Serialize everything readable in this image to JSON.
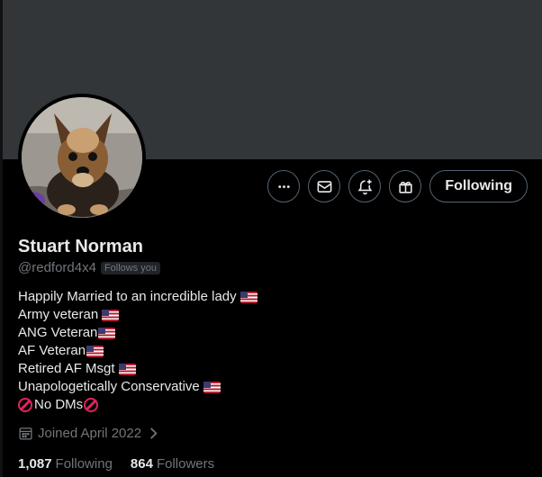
{
  "profile": {
    "display_name": "Stuart Norman",
    "handle": "@redford4x4",
    "follows_you_badge": "Follows you",
    "bio": [
      {
        "text": "Happily Married to an incredible lady",
        "suffix": "flag"
      },
      {
        "text": "Army veteran",
        "suffix": "flag"
      },
      {
        "text": "ANG Veteran",
        "suffix": "flag-tight"
      },
      {
        "text": "AF Veteran",
        "suffix": "flag-tight"
      },
      {
        "text": "Retired AF Msgt",
        "suffix": "flag"
      },
      {
        "text": "Unapologetically Conservative",
        "suffix": "flag"
      },
      {
        "text": "No DMs",
        "prefix": "no-entry",
        "suffix": "no-entry"
      }
    ],
    "joined": "Joined April 2022",
    "following_count": "1,087",
    "following_label": "Following",
    "followers_count": "864",
    "followers_label": "Followers"
  },
  "actions": {
    "more_icon": "more-icon",
    "message_icon": "envelope-icon",
    "notify_icon": "bell-plus-icon",
    "gift_icon": "gift-icon",
    "follow_label": "Following"
  },
  "colors": {
    "background": "#000000",
    "banner": "#333639",
    "primary_text": "#e7e9ea",
    "secondary_text": "#71767b",
    "border": "#536471"
  }
}
